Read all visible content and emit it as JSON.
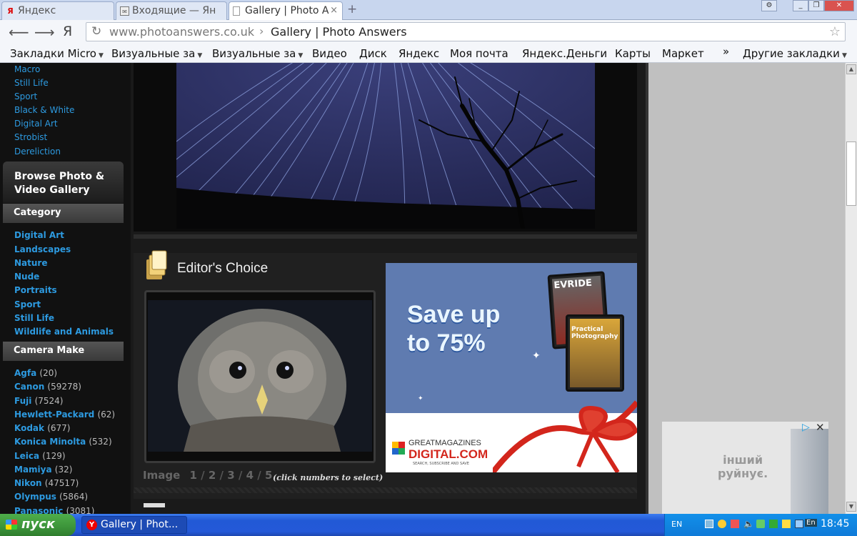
{
  "browser": {
    "tabs": [
      {
        "label": "Яндекс",
        "active": false
      },
      {
        "label": "Входящие — Ян",
        "active": false
      },
      {
        "label": "Gallery | Photo A",
        "active": true
      }
    ],
    "new_tab": "+",
    "yandex_logo": "Я",
    "address": {
      "domain": "www.photoanswers.co.uk",
      "separator": "›",
      "page_title": "Gallery | Photo Answers"
    },
    "bookmarks": [
      {
        "label": "Закладки Micro",
        "dropdown": true
      },
      {
        "label": "Визуальные за",
        "dropdown": true
      },
      {
        "label": "Визуальные за",
        "dropdown": true
      },
      {
        "label": "Видео",
        "dropdown": false
      },
      {
        "label": "Диск",
        "dropdown": false
      },
      {
        "label": "Яндекс",
        "dropdown": false
      },
      {
        "label": "Моя почта",
        "dropdown": false
      },
      {
        "label": "Яндекс.Деньги",
        "dropdown": false
      },
      {
        "label": "Карты",
        "dropdown": false
      },
      {
        "label": "Маркет",
        "dropdown": false
      }
    ],
    "overflow": "»",
    "other_bookmarks": "Другие закладки"
  },
  "sidebar": {
    "top_links": [
      "Macro",
      "Still Life",
      "Sport",
      "Black & White",
      "Digital Art",
      "Strobist",
      "Dereliction"
    ],
    "browse_title": "Browse Photo & Video Gallery",
    "category_heading": "Category",
    "categories": [
      "Digital Art",
      "Landscapes",
      "Nature",
      "Nude",
      "Portraits",
      "Sport",
      "Still Life",
      "Wildlife and Animals"
    ],
    "camera_heading": "Camera Make",
    "cameras": [
      {
        "name": "Agfa",
        "count": "(20)"
      },
      {
        "name": "Canon",
        "count": "(59278)"
      },
      {
        "name": "Fuji",
        "count": "(7524)"
      },
      {
        "name": "Hewlett-Packard",
        "count": "(62)"
      },
      {
        "name": "Kodak",
        "count": "(677)"
      },
      {
        "name": "Konica Minolta",
        "count": "(532)"
      },
      {
        "name": "Leica",
        "count": "(129)"
      },
      {
        "name": "Mamiya",
        "count": "(32)"
      },
      {
        "name": "Nikon",
        "count": "(47517)"
      },
      {
        "name": "Olympus",
        "count": "(5864)"
      },
      {
        "name": "Panasonic",
        "count": "(3081)"
      }
    ]
  },
  "editors_choice": {
    "title": "Editor's Choice",
    "pager_label": "Image",
    "pages": [
      "1",
      "2",
      "3",
      "4",
      "5"
    ],
    "hint": "(click numbers to select)"
  },
  "ad": {
    "headline_1": "Save up",
    "headline_2": "to 75%",
    "cover1": "EVRIDE",
    "cover2": "Practical Photography",
    "brand_1": "GREATMAGAZINES",
    "brand_2": "DIGITAL.COM",
    "tagline": "SEARCH, SUBSCRIBE AND SAVE"
  },
  "side_ad": {
    "text_1": "інший",
    "text_2": "руйнує."
  },
  "taskbar": {
    "start": "пуск",
    "task": "Gallery | Phot...",
    "lang": "EN",
    "lang2": "En",
    "clock": "18:45"
  }
}
